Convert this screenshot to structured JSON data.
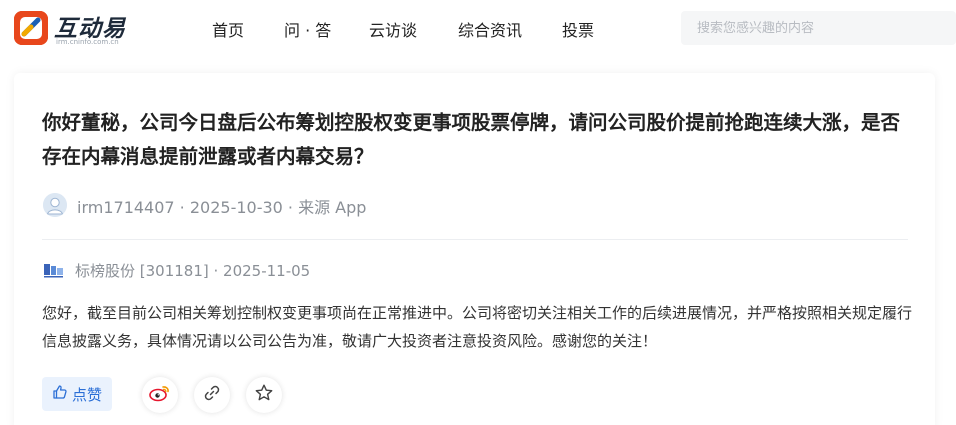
{
  "header": {
    "logo_text": "互动易",
    "logo_subtext": "irm.cninfo.com.cn",
    "brand_color": "#e8471c",
    "nav": [
      {
        "label": "首页"
      },
      {
        "label": "问 · 答"
      },
      {
        "label": "云访谈"
      },
      {
        "label": "综合资讯"
      },
      {
        "label": "投票"
      }
    ],
    "search_placeholder": "搜索您感兴趣的内容"
  },
  "qa": {
    "question": "你好董秘，公司今日盘后公布筹划控股权变更事项股票停牌，请问公司股价提前抢跑连续大涨，是否存在内幕消息提前泄露或者内幕交易？",
    "asker": {
      "meta": "irm1714407 · 2025-10-30 · 来源 App",
      "avatar_icon": "user-avatar-icon"
    },
    "company": {
      "meta": "标榜股份 [301181] · 2025-11-05",
      "logo_icon": "company-logo-icon"
    },
    "answer": "您好，截至目前公司相关筹划控制权变更事项尚在正常推进中。公司将密切关注相关工作的后续进展情况，并严格按照相关规定履行信息披露义务，具体情况请以公司公告为准，敬请广大投资者注意投资风险。感谢您的关注！"
  },
  "actions": {
    "like_label": "点赞",
    "like_icon": "thumbs-up-icon",
    "share_icons": [
      "weibo-icon",
      "link-icon",
      "star-icon"
    ],
    "accent_color": "#2b6fd6"
  }
}
